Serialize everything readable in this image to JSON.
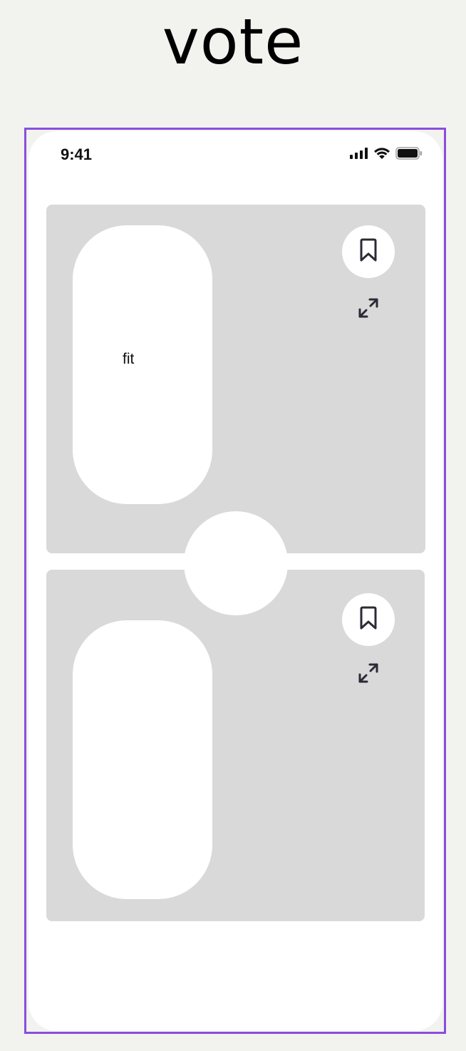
{
  "page": {
    "title": "vote"
  },
  "frame": {
    "outline_color": "#8a4ddf"
  },
  "status_bar": {
    "time": "9:41",
    "icons": [
      "cellular-signal-icon",
      "wifi-icon",
      "battery-icon"
    ]
  },
  "options": [
    {
      "label": "fit",
      "save_icon": "bookmark-icon",
      "expand_icon": "expand-icon"
    },
    {
      "label": "",
      "save_icon": "bookmark-icon",
      "expand_icon": "expand-icon"
    }
  ],
  "colors": {
    "background": "#f2f2ee",
    "card": "#d9d9d9",
    "surface": "#ffffff",
    "icon": "#2b2b36"
  }
}
